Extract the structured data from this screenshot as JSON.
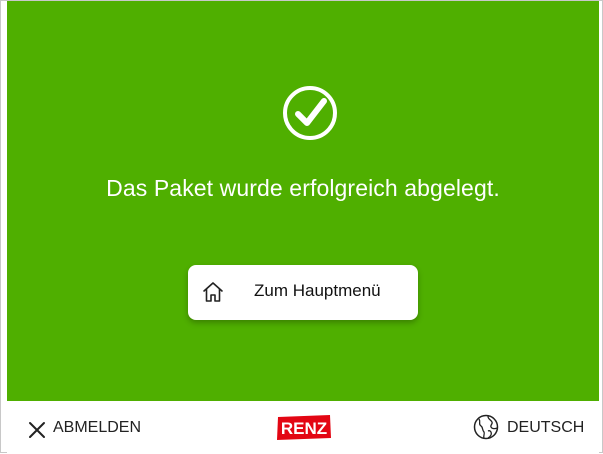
{
  "success": {
    "message": "Das Paket wurde erfolgreich abgelegt.",
    "icon": "check-circle-icon",
    "background_color": "#4faf00"
  },
  "home_button": {
    "label": "Zum Hauptmenü",
    "icon": "home-icon"
  },
  "footer": {
    "logout_label": "ABMELDEN",
    "logout_icon": "close-icon",
    "logo_text": "RENZ",
    "logo_color": "#e30613",
    "language_label": "DEUTSCH",
    "language_icon": "globe-icon"
  }
}
